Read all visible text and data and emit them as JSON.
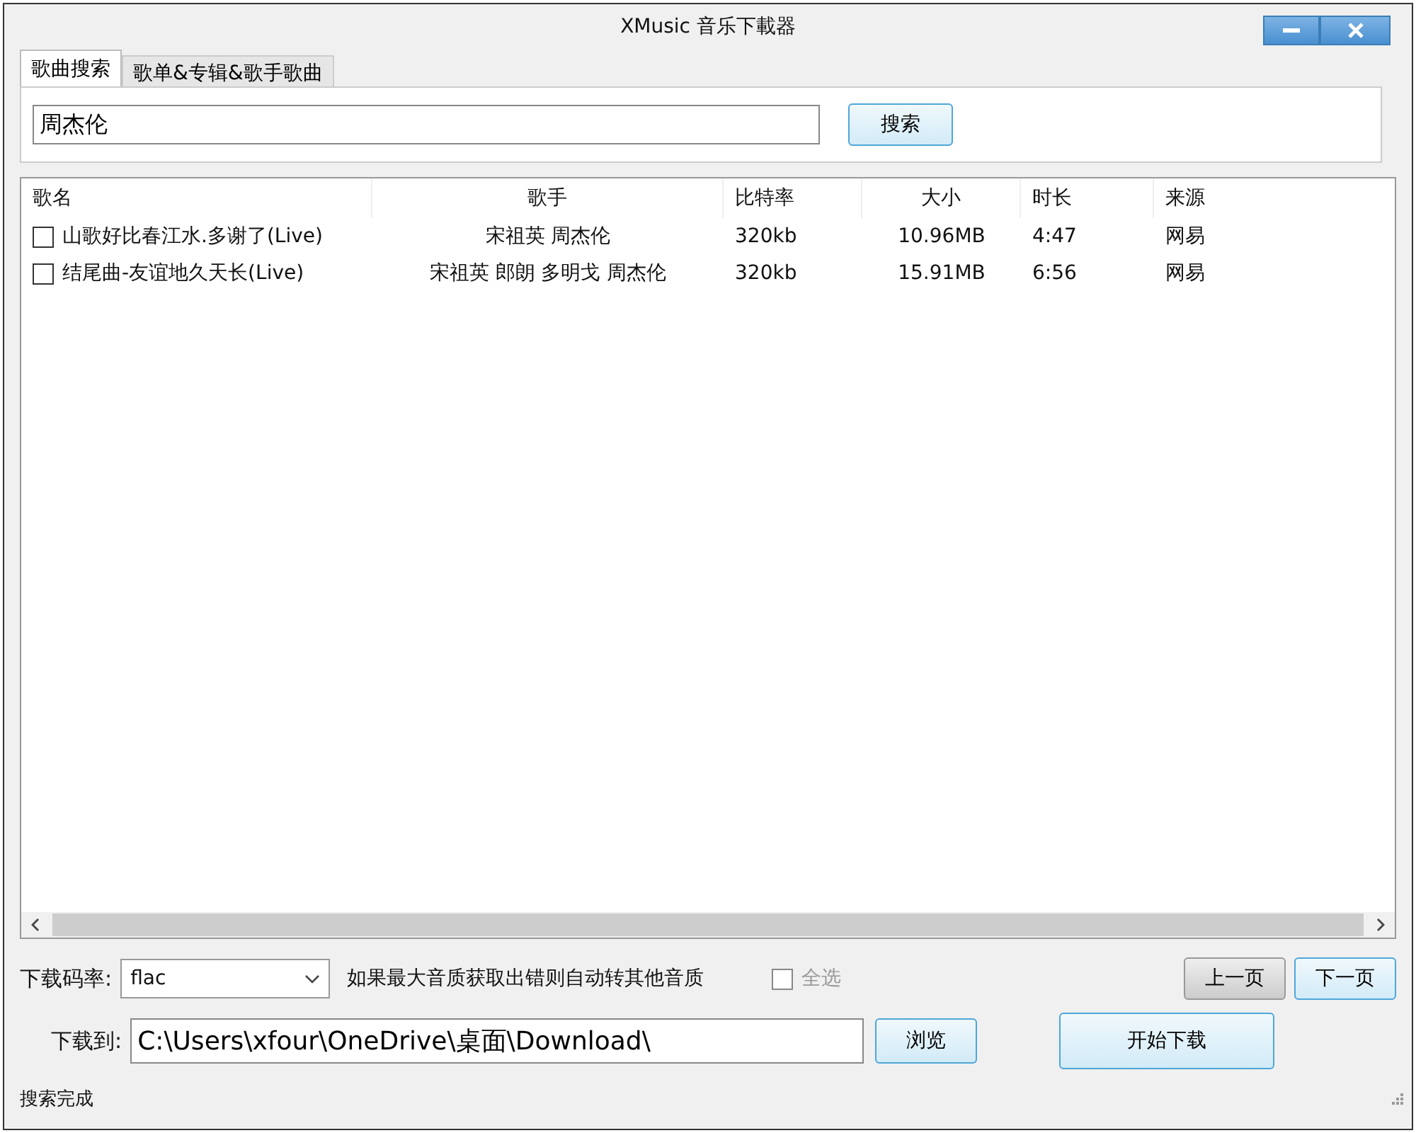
{
  "window": {
    "title": "XMusic 音乐下載器"
  },
  "tabs": [
    {
      "label": "歌曲搜索",
      "selected": true
    },
    {
      "label": "歌单&专辑&歌手歌曲",
      "selected": false
    }
  ],
  "search": {
    "value": "周杰伦",
    "button": "搜索"
  },
  "table": {
    "columns": [
      "歌名",
      "歌手",
      "比特率",
      "大小",
      "时长",
      "来源"
    ],
    "rows": [
      {
        "checked": false,
        "cells": [
          "山歌好比春江水.多谢了(Live)",
          "宋祖英 周杰伦",
          "320kb",
          "10.96MB",
          "4:47",
          "网易"
        ]
      },
      {
        "checked": false,
        "cells": [
          "结尾曲-友谊地久天长(Live)",
          "宋祖英 郎朗 多明戈 周杰伦",
          "320kb",
          "15.91MB",
          "6:56",
          "网易"
        ]
      }
    ]
  },
  "bitrate": {
    "label": "下载码率:",
    "value": "flac",
    "note": "如果最大音质获取出错则自动转其他音质"
  },
  "select_all": {
    "label": "全选",
    "checked": false
  },
  "pager": [
    "上一页",
    "下一页"
  ],
  "download": {
    "label": "下载到:",
    "value": "C:\\Users\\xfour\\OneDrive\\桌面\\Download\\",
    "browse": "浏览",
    "start": "开始下载"
  },
  "status_bar": "搜索完成"
}
